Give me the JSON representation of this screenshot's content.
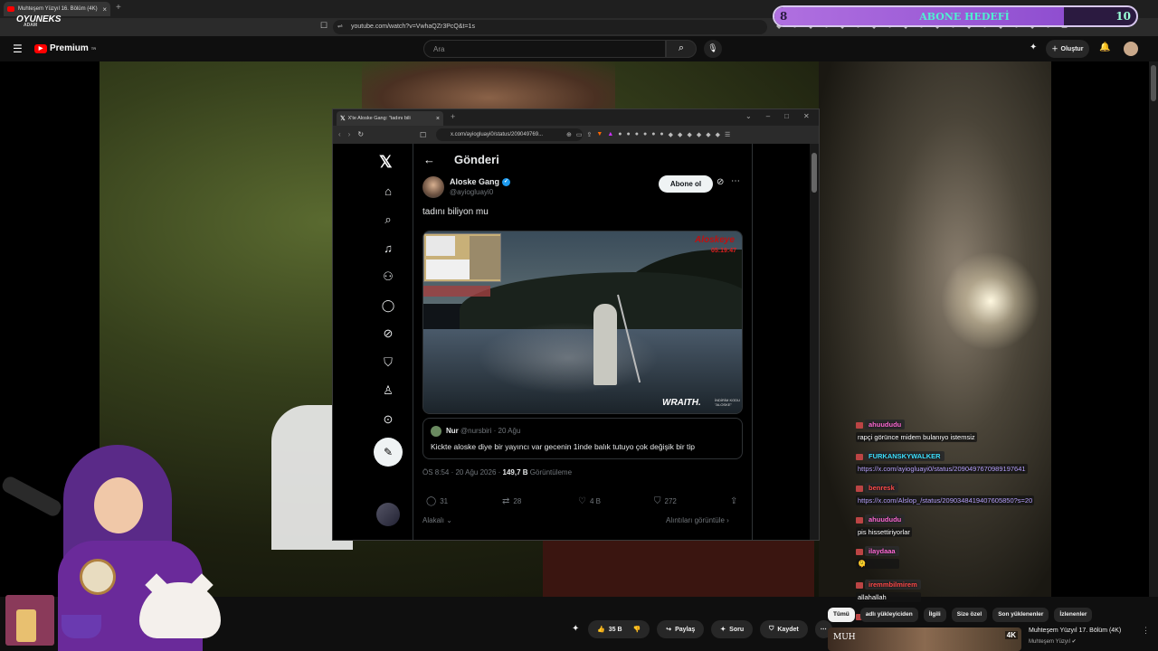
{
  "outer_browser": {
    "tab_title": "Muhteşem Yüzyıl 16. Bölüm (4K)",
    "url": "youtube.com/watch?v=VwhaQZr3PcQ&t=1s"
  },
  "stream_overlay": {
    "brand": "OYUNEKS",
    "brand_sub": "ADAM",
    "goal": {
      "left": "8",
      "title": "ABONE HEDEFİ",
      "right": "10",
      "progress": 0.8
    }
  },
  "youtube": {
    "logo": "Premium",
    "logo_sup": "TR",
    "search_placeholder": "Ara",
    "create_label": "Oluştur",
    "actions": {
      "like": "35 B",
      "share": "Paylaş",
      "ask": "Soru",
      "save": "Kaydet"
    },
    "chips": [
      "Tümü",
      "adlı yükleyiciden",
      "İlgili",
      "Size özel",
      "Son yüklenenler",
      "İzlenenler"
    ],
    "rec": {
      "title": "Muhteşem Yüzyıl 17. Bölüm (4K)",
      "channel": "Muhteşem Yüzyıl",
      "badge": "4K",
      "thumb_text": "MUH"
    }
  },
  "inner_browser": {
    "tab_title": "X'te Aloske Gang: \"tadını bili",
    "url": "x.com/ayiogluayi0/status/209049769..."
  },
  "x_post": {
    "header_title": "Gönderi",
    "author_name": "Aloske Gang",
    "author_handle": "@ayiogluayi0",
    "subscribe_label": "Abone ol",
    "text": "tadını biliyon mu",
    "media": {
      "tag": "Aloskeye",
      "time": "05:19:47",
      "sponsor": "WRAITH.",
      "code": "İNDİRİM KODU \"ALOSKE\""
    },
    "quote": {
      "name": "Nur",
      "handle": "@nursbiri",
      "date": "· 20 Ağu",
      "text": "Kickte aloske diye bir yayıncı var gecenin 1inde balık tutuyo çok değişik bir tip"
    },
    "meta_time": "ÖS 8:54 · 20 Ağu 2026 ·",
    "meta_views": "149,7 B",
    "meta_views_label": "Görüntüleme",
    "counts": {
      "replies": "31",
      "reposts": "28",
      "likes": "4 B",
      "bookmarks": "272"
    },
    "relevant_label": "Alakalı",
    "quotes_label": "Alıntıları görüntüle"
  },
  "chat": [
    {
      "name": "ahuududu",
      "name_color": "#ff6ad5",
      "msg": "rapçi görünce midem bulanıyo istemsiz",
      "is_link": false
    },
    {
      "name": "FURKANSKYWALKER",
      "name_color": "#3fe0ff",
      "msg": "https://x.com/ayiogluayi0/status/2090497670989197641",
      "is_link": true
    },
    {
      "name": "benresk",
      "name_color": "#ff4a4a",
      "msg": "https://x.com/Alslop_/status/2090348419407605850?s=20",
      "is_link": true
    },
    {
      "name": "ahuududu",
      "name_color": "#ff6ad5",
      "msg": "pis hissettiriyorlar",
      "is_link": false
    },
    {
      "name": "ilaydaaa",
      "name_color": "#ff6ad5",
      "msg": "🫠",
      "is_link": false
    },
    {
      "name": "iremmbilmirem",
      "name_color": "#ff4a4a",
      "msg": "allahallah",
      "is_link": false
    },
    {
      "name": "ahuududu",
      "name_color": "#ff6ad5",
      "msg": "",
      "is_link": false
    }
  ]
}
